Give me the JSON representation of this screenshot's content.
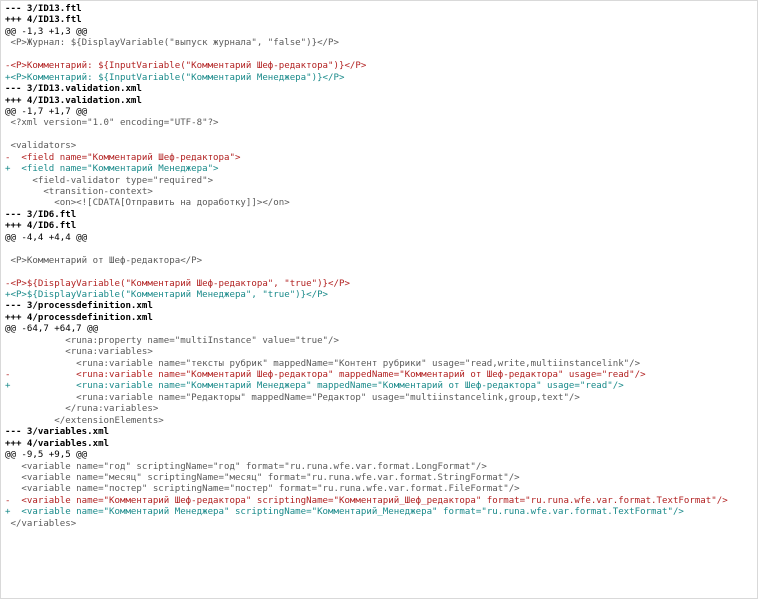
{
  "colors": {
    "header": "#000000",
    "context": "#5a5a5a",
    "deletion": "#b22222",
    "addition": "#1a8a8a",
    "background": "#ffffff"
  },
  "diff": {
    "lines": [
      {
        "type": "hdr",
        "text": "--- 3/ID13.ftl"
      },
      {
        "type": "hdr",
        "text": "+++ 4/ID13.ftl"
      },
      {
        "type": "hunk",
        "text": "@@ -1,3 +1,3 @@"
      },
      {
        "type": "ctx",
        "text": " <P>Журнал: ${DisplayVariable(\"выпуск журнала\", \"false\")}</P>"
      },
      {
        "type": "blank",
        "text": ""
      },
      {
        "type": "del",
        "text": "-<P>Комментарий: ${InputVariable(\"Комментарий Шеф-редактора\")}</P>"
      },
      {
        "type": "add",
        "text": "+<P>Комментарий: ${InputVariable(\"Комментарий Менеджера\")}</P>"
      },
      {
        "type": "hdr",
        "text": "--- 3/ID13.validation.xml"
      },
      {
        "type": "hdr",
        "text": "+++ 4/ID13.validation.xml"
      },
      {
        "type": "hunk",
        "text": "@@ -1,7 +1,7 @@"
      },
      {
        "type": "ctx",
        "text": " <?xml version=\"1.0\" encoding=\"UTF-8\"?>"
      },
      {
        "type": "blank",
        "text": ""
      },
      {
        "type": "ctx",
        "text": " <validators>"
      },
      {
        "type": "del",
        "text": "-  <field name=\"Комментарий Шеф-редактора\">"
      },
      {
        "type": "add",
        "text": "+  <field name=\"Комментарий Менеджера\">"
      },
      {
        "type": "ctx",
        "text": "     <field-validator type=\"required\">"
      },
      {
        "type": "ctx",
        "text": "       <transition-context>"
      },
      {
        "type": "ctx",
        "text": "         <on><![CDATA[Отправить на доработку]]></on>"
      },
      {
        "type": "hdr",
        "text": "--- 3/ID6.ftl"
      },
      {
        "type": "hdr",
        "text": "+++ 4/ID6.ftl"
      },
      {
        "type": "hunk",
        "text": "@@ -4,4 +4,4 @@"
      },
      {
        "type": "blank",
        "text": ""
      },
      {
        "type": "ctx",
        "text": " <P>Комментарий от Шеф-редактора</P>"
      },
      {
        "type": "blank",
        "text": ""
      },
      {
        "type": "del",
        "text": "-<P>${DisplayVariable(\"Комментарий Шеф-редактора\", \"true\")}</P>"
      },
      {
        "type": "add",
        "text": "+<P>${DisplayVariable(\"Комментарий Менеджера\", \"true\")}</P>"
      },
      {
        "type": "hdr",
        "text": "--- 3/processdefinition.xml"
      },
      {
        "type": "hdr",
        "text": "+++ 4/processdefinition.xml"
      },
      {
        "type": "hunk",
        "text": "@@ -64,7 +64,7 @@"
      },
      {
        "type": "ctx",
        "text": "           <runa:property name=\"multiInstance\" value=\"true\"/>"
      },
      {
        "type": "ctx",
        "text": "           <runa:variables>"
      },
      {
        "type": "ctx",
        "text": "             <runa:variable name=\"тексты рубрик\" mappedName=\"Контент рубрики\" usage=\"read,write,multiinstancelink\"/>"
      },
      {
        "type": "del",
        "text": "-            <runa:variable name=\"Комментарий Шеф-редактора\" mappedName=\"Комментарий от Шеф-редактора\" usage=\"read\"/>"
      },
      {
        "type": "add",
        "text": "+            <runa:variable name=\"Комментарий Менеджера\" mappedName=\"Комментарий от Шеф-редактора\" usage=\"read\"/>"
      },
      {
        "type": "ctx",
        "text": "             <runa:variable name=\"Редакторы\" mappedName=\"Редактор\" usage=\"multiinstancelink,group,text\"/>"
      },
      {
        "type": "ctx",
        "text": "           </runa:variables>"
      },
      {
        "type": "ctx",
        "text": "         </extensionElements>"
      },
      {
        "type": "hdr",
        "text": "--- 3/variables.xml"
      },
      {
        "type": "hdr",
        "text": "+++ 4/variables.xml"
      },
      {
        "type": "hunk",
        "text": "@@ -9,5 +9,5 @@"
      },
      {
        "type": "ctx",
        "text": "   <variable name=\"год\" scriptingName=\"год\" format=\"ru.runa.wfe.var.format.LongFormat\"/>"
      },
      {
        "type": "ctx",
        "text": "   <variable name=\"месяц\" scriptingName=\"месяц\" format=\"ru.runa.wfe.var.format.StringFormat\"/>"
      },
      {
        "type": "ctx",
        "text": "   <variable name=\"постер\" scriptingName=\"постер\" format=\"ru.runa.wfe.var.format.FileFormat\"/>"
      },
      {
        "type": "del",
        "text": "-  <variable name=\"Комментарий Шеф-редактора\" scriptingName=\"Комментарий_Шеф_редактора\" format=\"ru.runa.wfe.var.format.TextFormat\"/>"
      },
      {
        "type": "add",
        "text": "+  <variable name=\"Комментарий Менеджера\" scriptingName=\"Комментарий_Менеджера\" format=\"ru.runa.wfe.var.format.TextFormat\"/>"
      },
      {
        "type": "ctx",
        "text": " </variables>"
      }
    ]
  }
}
